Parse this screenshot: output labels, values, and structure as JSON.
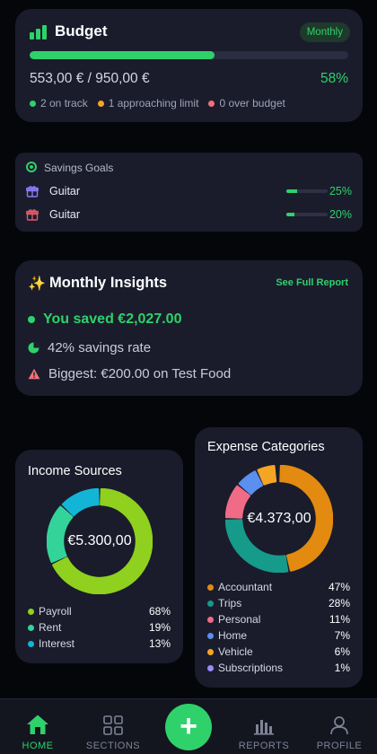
{
  "budget": {
    "title": "Budget",
    "badge": "Monthly",
    "amount": "553,00 € / 950,00 €",
    "percent": "58%",
    "progress_fraction": 0.58,
    "legend": [
      {
        "label": "2 on track",
        "color": "#2fd16a"
      },
      {
        "label": "1 approaching limit",
        "color": "#f5a524"
      },
      {
        "label": "0 over budget",
        "color": "#f07178"
      }
    ]
  },
  "savings": {
    "title": "Savings Goals",
    "goals": [
      {
        "name": "Guitar",
        "percent": "25%",
        "fraction": 0.25,
        "icon": "gift-icon",
        "icon_color": "#8b7cf6"
      },
      {
        "name": "Guitar",
        "percent": "20%",
        "fraction": 0.2,
        "icon": "gift-icon",
        "icon_color": "#e05a6a"
      }
    ]
  },
  "insights": {
    "title": "Monthly Insights",
    "link": "See Full Report",
    "saved": "You saved €2,027.00",
    "rate": "42% savings rate",
    "biggest": "Biggest: €200.00 on Test Food"
  },
  "income": {
    "title": "Income Sources",
    "total": "€5.300,00",
    "items": [
      {
        "name": "Payroll",
        "percent": "68%",
        "value": 68,
        "color": "#8fd11e"
      },
      {
        "name": "Rent",
        "percent": "19%",
        "value": 19,
        "color": "#33d39a"
      },
      {
        "name": "Interest",
        "percent": "13%",
        "value": 13,
        "color": "#13b5d6"
      }
    ]
  },
  "expense": {
    "title": "Expense Categories",
    "total": "€4.373,00",
    "items": [
      {
        "name": "Accountant",
        "percent": "47%",
        "value": 47,
        "color": "#e38a10"
      },
      {
        "name": "Trips",
        "percent": "28%",
        "value": 28,
        "color": "#169a8a"
      },
      {
        "name": "Personal",
        "percent": "11%",
        "value": 11,
        "color": "#f06b86"
      },
      {
        "name": "Home",
        "percent": "7%",
        "value": 7,
        "color": "#5b8ff0"
      },
      {
        "name": "Vehicle",
        "percent": "6%",
        "value": 6,
        "color": "#f5a524"
      },
      {
        "name": "Subscriptions",
        "percent": "1%",
        "value": 1,
        "color": "#9b8cf5"
      }
    ]
  },
  "nav": {
    "home": "HOME",
    "sections": "SECTIONS",
    "reports": "REPORTS",
    "profile": "PROFILE",
    "add": "+"
  }
}
